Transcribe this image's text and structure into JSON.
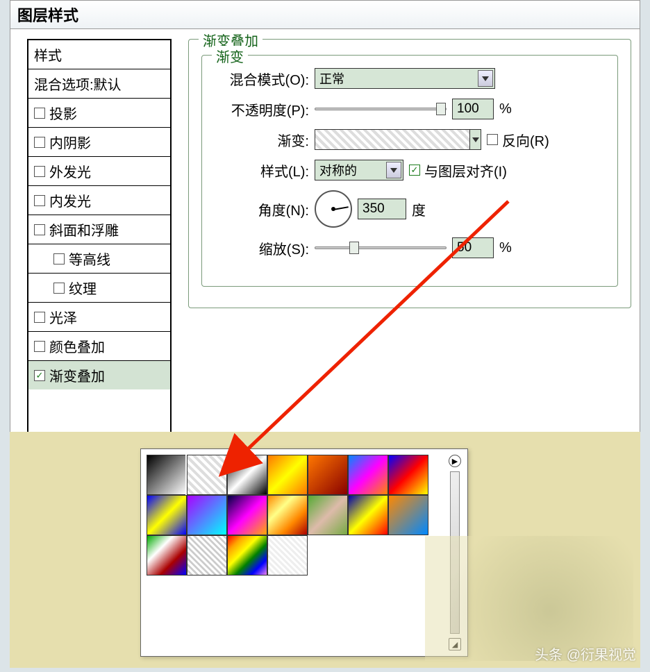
{
  "dialog": {
    "title": "图层样式"
  },
  "styles": {
    "header": "样式",
    "blending": "混合选项:默认",
    "items": [
      {
        "label": "投影",
        "checked": false,
        "indent": false
      },
      {
        "label": "内阴影",
        "checked": false,
        "indent": false
      },
      {
        "label": "外发光",
        "checked": false,
        "indent": false
      },
      {
        "label": "内发光",
        "checked": false,
        "indent": false
      },
      {
        "label": "斜面和浮雕",
        "checked": false,
        "indent": false
      },
      {
        "label": "等高线",
        "checked": false,
        "indent": true
      },
      {
        "label": "纹理",
        "checked": false,
        "indent": true
      },
      {
        "label": "光泽",
        "checked": false,
        "indent": false
      },
      {
        "label": "颜色叠加",
        "checked": false,
        "indent": false
      },
      {
        "label": "渐变叠加",
        "checked": true,
        "indent": false,
        "selected": true
      }
    ]
  },
  "panel": {
    "group_title": "渐变叠加",
    "inner_title": "渐变",
    "blend_mode_label": "混合模式(O):",
    "blend_mode_value": "正常",
    "opacity_label": "不透明度(P):",
    "opacity_value": "100",
    "opacity_unit": "%",
    "gradient_label": "渐变:",
    "reverse_label": "反向(R)",
    "reverse_checked": false,
    "style_label": "样式(L):",
    "style_value": "对称的",
    "align_label": "与图层对齐(I)",
    "align_checked": true,
    "angle_label": "角度(N):",
    "angle_value": "350",
    "angle_unit": "度",
    "scale_label": "缩放(S):",
    "scale_value": "50",
    "scale_unit": "%"
  },
  "picker": {
    "swatches": [
      "linear-gradient(135deg,#000,#fff)",
      "repeating-linear-gradient(45deg,#fff,#fff 4px,#ddd 4px,#ddd 8px)",
      "linear-gradient(135deg,#000,#fff,#000)",
      "linear-gradient(135deg,#f70,#ff0,#f70)",
      "linear-gradient(135deg,#f70,#800)",
      "linear-gradient(135deg,#08f,#f0f,#f80)",
      "linear-gradient(135deg,#00f,#f00,#ff0)",
      "linear-gradient(135deg,#00f,#ff0,#00f)",
      "linear-gradient(135deg,#a0f,#0ff)",
      "linear-gradient(135deg,#004,#f0f,#fa0)",
      "linear-gradient(135deg,#f80,#ff8,#f80,#a00)",
      "linear-gradient(135deg,#5a3,#dba,#7a4)",
      "linear-gradient(135deg,#00a,#ff0,#f00)",
      "linear-gradient(135deg,#f80,#08f)",
      "linear-gradient(135deg,#0a0,#fff,#a00,#00f)",
      "repeating-linear-gradient(45deg,#fff,#fff 3px,#ccc 3px,#ccc 6px)",
      "linear-gradient(135deg,red,orange,yellow,green,blue,violet)",
      "repeating-linear-gradient(45deg,#eee,#eee 3px,#fff 3px,#fff 6px)"
    ]
  },
  "watermark": "头条 @衍果视觉"
}
